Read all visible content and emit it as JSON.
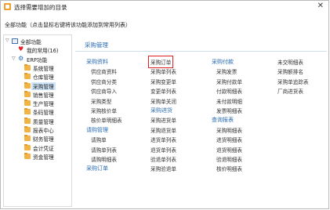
{
  "window": {
    "title": "选择需要增加的目录",
    "close_glyph": "✕",
    "hint": "全部功能（点击鼠标右键将该功能添加到常用列表）"
  },
  "tree": {
    "root": "全部功能",
    "favorites": "我的常用(16)",
    "erp": "ERP功能",
    "items": [
      "系统管理",
      "仓库管理",
      "采购管理",
      "销售管理",
      "生产管理",
      "条码管理",
      "质量管理",
      "报表中心",
      "财务管理",
      "会计凭证",
      "资金管理"
    ],
    "selected": "采购管理"
  },
  "main": {
    "title": "采购管理",
    "col1": [
      "采购资料",
      "供应商资料",
      "供应商分类",
      "供应商导入",
      "采购类型",
      "采购核价单",
      "核价单明细表",
      "请购管理",
      "请购单",
      "请购单列表",
      "请购明细表",
      "采购订单"
    ],
    "col2": [
      "采购订单",
      "采购单列表",
      "采购变更单",
      "变更单列表",
      "采购单关闭",
      "采购进货",
      "采购进货单",
      "采购退货单",
      "进货单列表",
      "退货单列表",
      "验退单列表",
      "采购验退单"
    ],
    "col3": [
      "采购付款",
      "采购发票",
      "采购付款单",
      "付款明细表",
      "未付款明细",
      "发票明细表",
      "查询报表",
      "采购明细表",
      "进货明细表",
      "退货明细表",
      "验退明细表",
      "核价明细表"
    ],
    "col4": [
      "未交明细表",
      "采购额排名",
      "采购单追踪表",
      "厂商进货表"
    ],
    "highlighted": "采购订单"
  },
  "colors": {
    "accent_blue": "#2a6bb5",
    "highlight_red": "#e02020",
    "selection": "#cfe5fa",
    "folder": "#f2b344"
  }
}
